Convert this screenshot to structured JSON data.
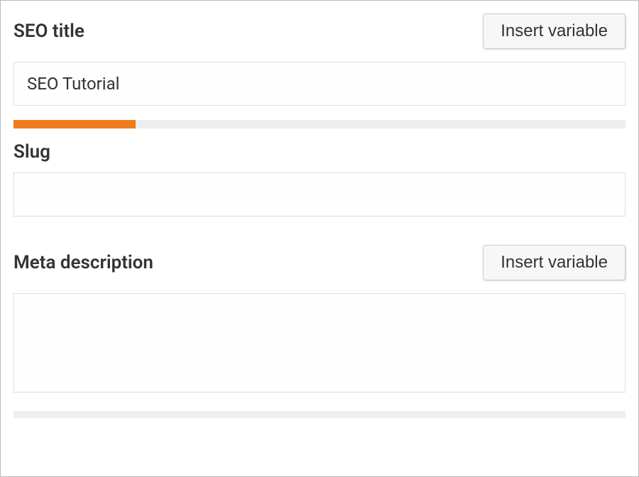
{
  "seo_title": {
    "label": "SEO title",
    "insert_button": "Insert variable",
    "value": "SEO Tutorial",
    "progress_percent": 20,
    "progress_color": "#ee7c1b"
  },
  "slug": {
    "label": "Slug",
    "value": ""
  },
  "meta_description": {
    "label": "Meta description",
    "insert_button": "Insert variable",
    "value": ""
  }
}
